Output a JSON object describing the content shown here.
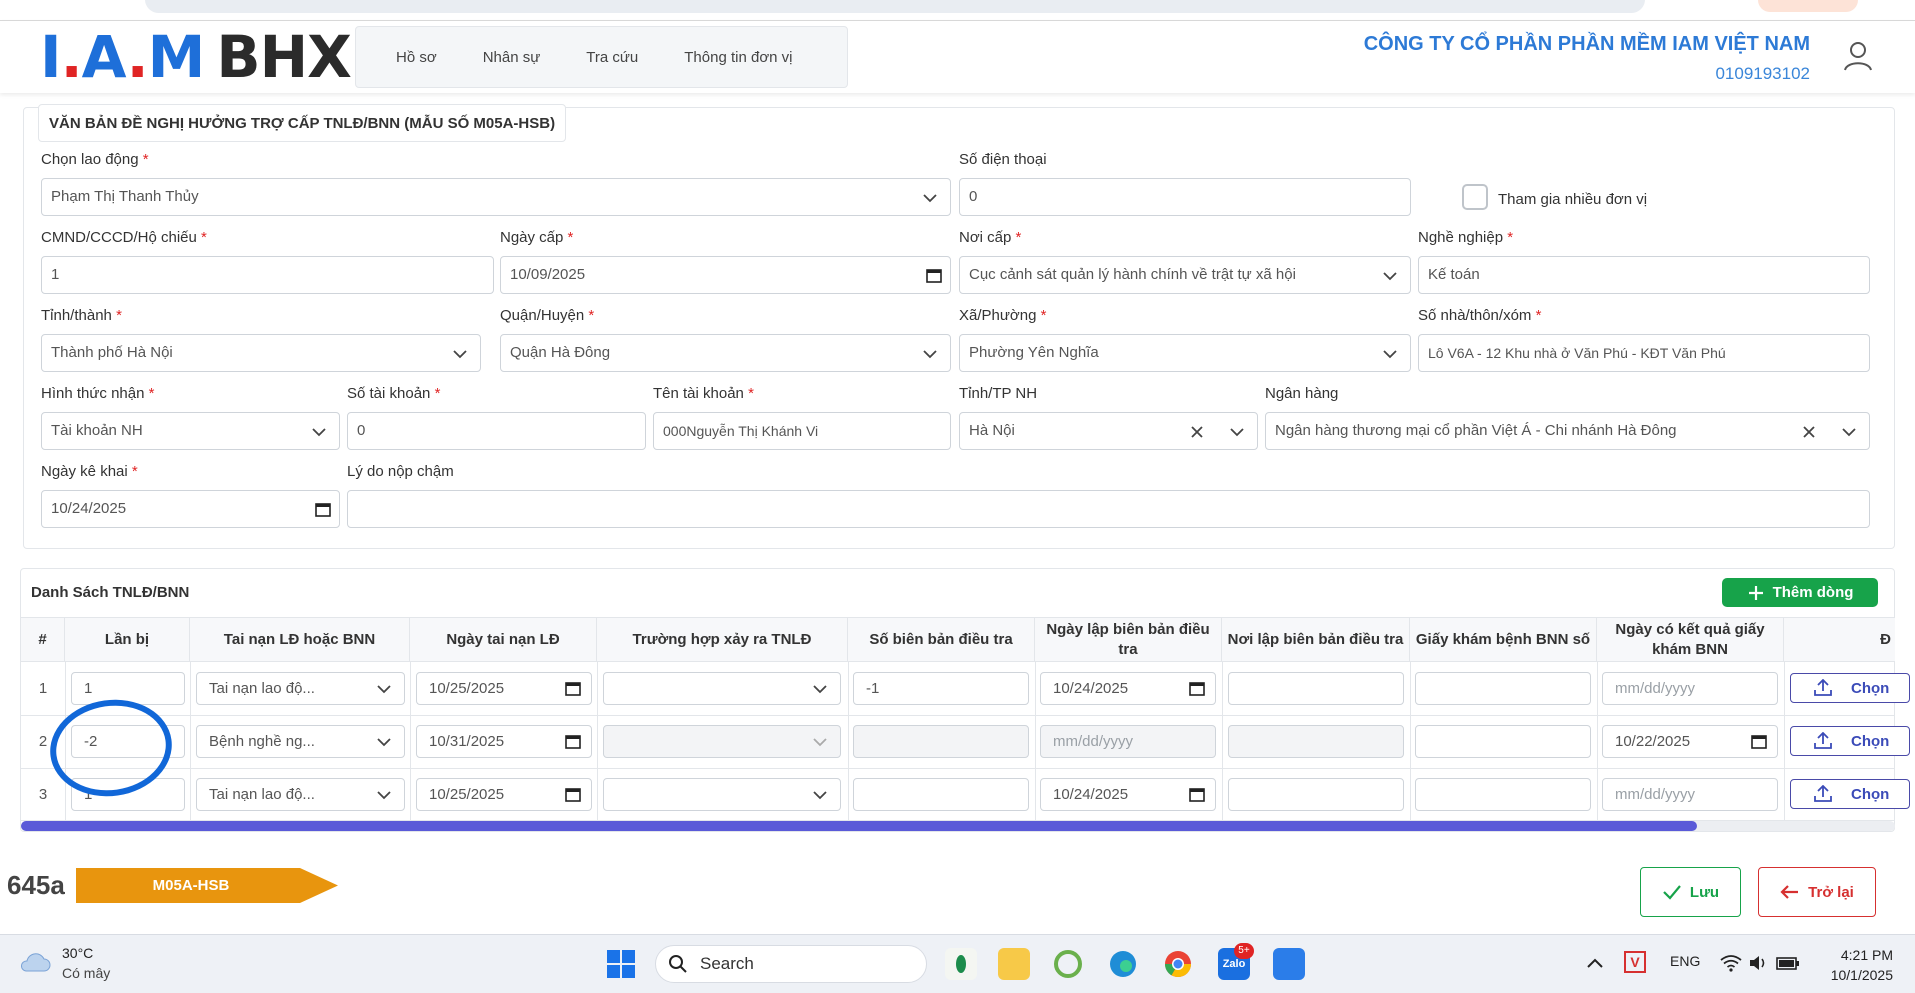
{
  "header": {
    "logo_iam_parts": [
      "I",
      ".",
      "A",
      ".",
      "M"
    ],
    "logo_bhxh": "BHXH",
    "nav": [
      "Hồ sơ",
      "Nhân sự",
      "Tra cứu",
      "Thông tin đơn vị"
    ],
    "company_name": "CÔNG TY CỔ PHẦN PHẦN MỀM IAM VIỆT NAM",
    "company_tax": "0109193102"
  },
  "form": {
    "title": "VĂN BẢN ĐỀ NGHỊ HƯỞNG TRỢ CẤP TNLĐ/BNN (MẪU SỐ M05A-HSB)",
    "employee": {
      "label": "Chọn lao động",
      "value": "Phạm Thị Thanh Thủy"
    },
    "phone": {
      "label": "Số điện thoại",
      "value": "0"
    },
    "multi_unit": {
      "label": "Tham gia nhiều đơn vị",
      "checked": false
    },
    "id_number": {
      "label": "CMND/CCCD/Hộ chiếu",
      "value": "1"
    },
    "issue_date": {
      "label": "Ngày cấp",
      "value": "10/09/2025"
    },
    "issue_place": {
      "label": "Nơi cấp",
      "value": "Cục cảnh sát quản lý hành chính về trật tự xã hội"
    },
    "occupation": {
      "label": "Nghề nghiệp",
      "value": "Kế toán"
    },
    "province": {
      "label": "Tỉnh/thành",
      "value": "Thành phố Hà Nội"
    },
    "district": {
      "label": "Quận/Huyện",
      "value": "Quận Hà Đông"
    },
    "ward": {
      "label": "Xã/Phường",
      "value": "Phường Yên Nghĩa"
    },
    "address": {
      "label": "Số nhà/thôn/xóm",
      "value": "Lô V6A - 12 Khu nhà ở Văn Phú - KĐT Văn Phú"
    },
    "receive_method": {
      "label": "Hình thức nhận",
      "value": "Tài khoản NH"
    },
    "account_no": {
      "label": "Số tài khoản",
      "value": "0"
    },
    "account_name": {
      "label": "Tên tài khoản",
      "value": "000Nguyễn Thị Khánh Vi"
    },
    "bank_province": {
      "label": "Tỉnh/TP NH",
      "value": "Hà Nội"
    },
    "bank": {
      "label": "Ngân hàng",
      "value": "Ngân hàng thương mại cổ phần Việt Á - Chi nhánh Hà Đông"
    },
    "declare_date": {
      "label": "Ngày kê khai",
      "value": "10/24/2025"
    },
    "late_reason": {
      "label": "Lý do nộp chậm",
      "value": ""
    }
  },
  "table": {
    "title": "Danh Sách TNLĐ/BNN",
    "add_button": "Thêm dòng",
    "columns": [
      "#",
      "Lần bị",
      "Tai nạn LĐ hoặc BNN",
      "Ngày tai nạn LĐ",
      "Trường hợp xảy ra TNLĐ",
      "Số biên bản điều tra",
      "Ngày lập biên bản điều tra",
      "Nơi lập biên bản điều tra",
      "Giấy khám bệnh BNN số",
      "Ngày có kết quả giấy khám BNN",
      "Đ"
    ],
    "date_placeholder": "mm/dd/yyyy",
    "upload_label": "Chọn",
    "rows": [
      {
        "no": "1",
        "times": "1",
        "type": "Tai nạn lao độ...",
        "accident_date": "10/25/2025",
        "case": "",
        "report_no": "-1",
        "report_date": "10/24/2025",
        "report_place": "",
        "bnn_no": "",
        "bnn_date": ""
      },
      {
        "no": "2",
        "times": "-2",
        "type": "Bệnh nghề ng...",
        "accident_date": "10/31/2025",
        "case": "",
        "report_no": "",
        "report_date": "",
        "report_place": "",
        "bnn_no": "",
        "bnn_date": "10/22/2025"
      },
      {
        "no": "3",
        "times": "1",
        "type": "Tai nạn lao độ...",
        "accident_date": "10/25/2025",
        "case": "",
        "report_no": "",
        "report_date": "10/24/2025",
        "report_place": "",
        "bnn_no": "",
        "bnn_date": ""
      }
    ]
  },
  "footer": {
    "doc_code": "645a",
    "form_tag": "M05A-HSB",
    "save": "Lưu",
    "back": "Trở lại"
  },
  "taskbar": {
    "temperature": "30°C",
    "weather": "Có mây",
    "search": "Search",
    "zalo_badge": "5+",
    "lang": "ENG",
    "time": "4:21 PM",
    "date": "10/1/2025"
  },
  "colors": {
    "primary_blue": "#1e6fd9",
    "green": "#17a34a",
    "red": "#d63030",
    "orange": "#e8950e",
    "scroll": "#5a5ad8"
  }
}
